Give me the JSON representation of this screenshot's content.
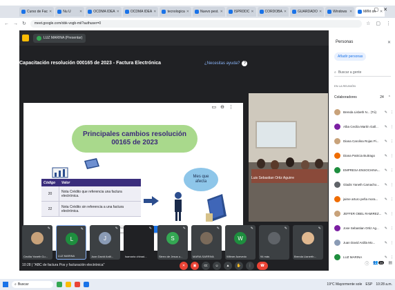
{
  "browser": {
    "tabs": [
      {
        "label": "Curso de Fac",
        "active": false
      },
      {
        "label": "Nu U",
        "active": false
      },
      {
        "label": "OCDMA IDEA",
        "active": false
      },
      {
        "label": "OCDMA IDEA",
        "active": false
      },
      {
        "label": "tecnologica",
        "active": false
      },
      {
        "label": "Nuevo pest.",
        "active": false
      },
      {
        "label": "ISPRDDC",
        "active": false
      },
      {
        "label": "CORDOBA",
        "active": false
      },
      {
        "label": "GUARDADO",
        "active": false
      },
      {
        "label": "Windows",
        "active": false
      },
      {
        "label": "Meet oh",
        "active": true
      }
    ],
    "url": "meet.google.com/obk-vogb-mii?authuser=0"
  },
  "meet": {
    "presenter_chip": "LUZ MARINA (Presentar)",
    "title": "Capacitación resolución 000165 de 2023 - Factura Electrónica",
    "help_link": "¿Necesitas ayuda?",
    "slide": {
      "headline_1": "Principales cambios resolución",
      "headline_2": "00165 de 2023",
      "bubble_1": "Mes que",
      "bubble_2": "afecta",
      "table": {
        "headers": [
          "Código",
          "Valor"
        ],
        "rows": [
          {
            "code": "20",
            "desc": "Nota Crédito que referencia una factura electrónica."
          },
          {
            "code": "22",
            "desc": "Nota Crédito sin referencia a una factura electrónica."
          }
        ]
      },
      "share_bar": {
        "text": "meet.google.com está compartiendo una pestaña",
        "stop": "Dejar de compartir",
        "hide": "Ocultar"
      }
    },
    "camera_label": "Luis Sebastian Ortiz Aguirre",
    "tiles": [
      {
        "name": "Cecilia Yaneth Cu...",
        "kind": "photo",
        "color": "#c8a27a"
      },
      {
        "name": "LUZ MARINA",
        "kind": "letter",
        "letter": "L",
        "color": "#1e8e3e",
        "selected": true
      },
      {
        "name": "Juan David Ardil...",
        "kind": "letter",
        "letter": "J",
        "color": "#8a9bb5"
      },
      {
        "name": "Isamaria chinad...",
        "kind": "blank",
        "color": "#202124"
      },
      {
        "name": "Sierro de Jesus o...",
        "kind": "letter",
        "letter": "S",
        "color": "#34a853"
      },
      {
        "name": "MARIA SARRIVA",
        "kind": "photo",
        "color": "#7a6a5a"
      },
      {
        "name": "Wilmer Acevedo",
        "kind": "letter",
        "letter": "W",
        "color": "#1e8e3e"
      },
      {
        "name": "94 más",
        "kind": "letter",
        "letter": "",
        "color": "#5f6368"
      },
      {
        "name": "Brenda Llanerth...",
        "kind": "photo",
        "color": "#e0b890"
      }
    ],
    "time_title": "10:28  |  \"ABC de factura Pos y facturación electrónica\""
  },
  "panel": {
    "title": "Personas",
    "add_label": "Añadir personas",
    "search_placeholder": "Buscar a gente",
    "section": "EN LA REUNIÓN",
    "collab_label": "Colaboradores",
    "collab_count": "24",
    "people": [
      {
        "name": "Brenda Lisbeth N... (Tú)",
        "color": "#c8a27a"
      },
      {
        "name": "Alba Cecilia Martín Gall...",
        "color": "#7b1fa2"
      },
      {
        "name": "Diana Carolina Rojas Pi...",
        "color": "#c8a27a"
      },
      {
        "name": "Diana Patricia Buitrago",
        "color": "#ef6c00"
      },
      {
        "name": "EMPRESA ENSOCHINA...",
        "color": "#1e8e3e"
      },
      {
        "name": "Gladis Yaneth Camacho...",
        "color": "#5f6368"
      },
      {
        "name": "jaime arturo peña mora...",
        "color": "#ef6c00"
      },
      {
        "name": "JEFFER OBEL RAMIREZ...",
        "color": "#c8a27a"
      },
      {
        "name": "Jose Sebastian Ortiz Ag...",
        "color": "#7b1fa2"
      },
      {
        "name": "Juan David Ardila Mo...",
        "color": "#8a9bb5"
      },
      {
        "name": "LUZ MARINA",
        "color": "#1e8e3e"
      }
    ],
    "badge": "24"
  },
  "taskbar": {
    "search": "Buscar",
    "tray_text": "19°C  Mayormente sole",
    "lang": "ESP",
    "clock": "10:28 a.m."
  }
}
